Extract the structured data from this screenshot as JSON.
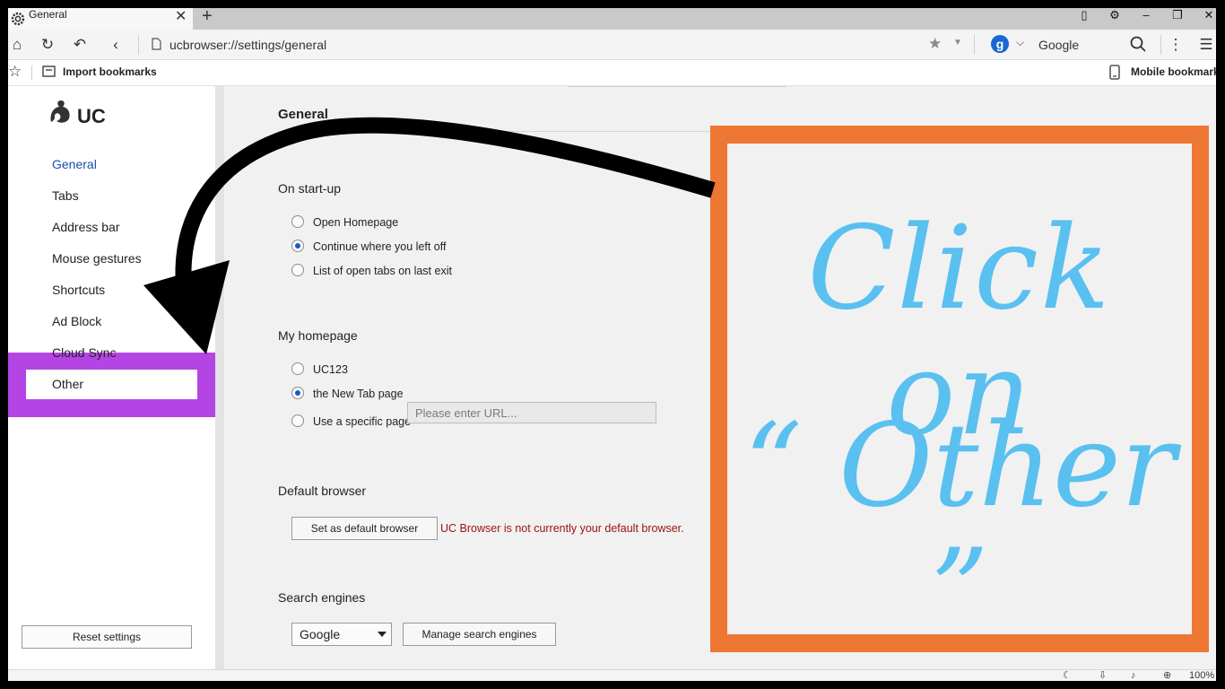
{
  "tab": {
    "title": "General"
  },
  "address": {
    "url": "ucbrowser://settings/general",
    "search_engine": "Google",
    "search_badge": "g"
  },
  "bookmarks": {
    "import_label": "Import bookmarks",
    "mobile_label": "Mobile bookmarks"
  },
  "sidebar": {
    "logo_text": "UC",
    "items": [
      {
        "label": "General",
        "active": true
      },
      {
        "label": "Tabs"
      },
      {
        "label": "Address bar"
      },
      {
        "label": "Mouse gestures"
      },
      {
        "label": "Shortcuts"
      },
      {
        "label": "Ad Block"
      },
      {
        "label": "Cloud Sync"
      },
      {
        "label": "Other"
      }
    ],
    "reset_label": "Reset settings"
  },
  "main": {
    "title": "General",
    "startup": {
      "heading": "On start-up",
      "options": [
        "Open Homepage",
        "Continue where you left off",
        "List of open tabs on last exit"
      ],
      "selected": "Continue where you left off"
    },
    "homepage": {
      "heading": "My homepage",
      "options": [
        "UC123",
        "the New Tab page",
        "Use a specific page"
      ],
      "selected": "the New Tab page",
      "url_placeholder": "Please enter URL..."
    },
    "default_browser": {
      "heading": "Default browser",
      "button": "Set as default browser",
      "status": "UC Browser is not currently your default browser."
    },
    "search": {
      "heading": "Search engines",
      "selected": "Google",
      "manage_button": "Manage search engines"
    }
  },
  "status": {
    "zoom": "100%"
  },
  "annotation": {
    "line1": "Click on",
    "line2": "“ Other ”",
    "text_color": "#5ac0f0",
    "box_color": "#ee7733",
    "highlight_color": "#b445e4"
  }
}
